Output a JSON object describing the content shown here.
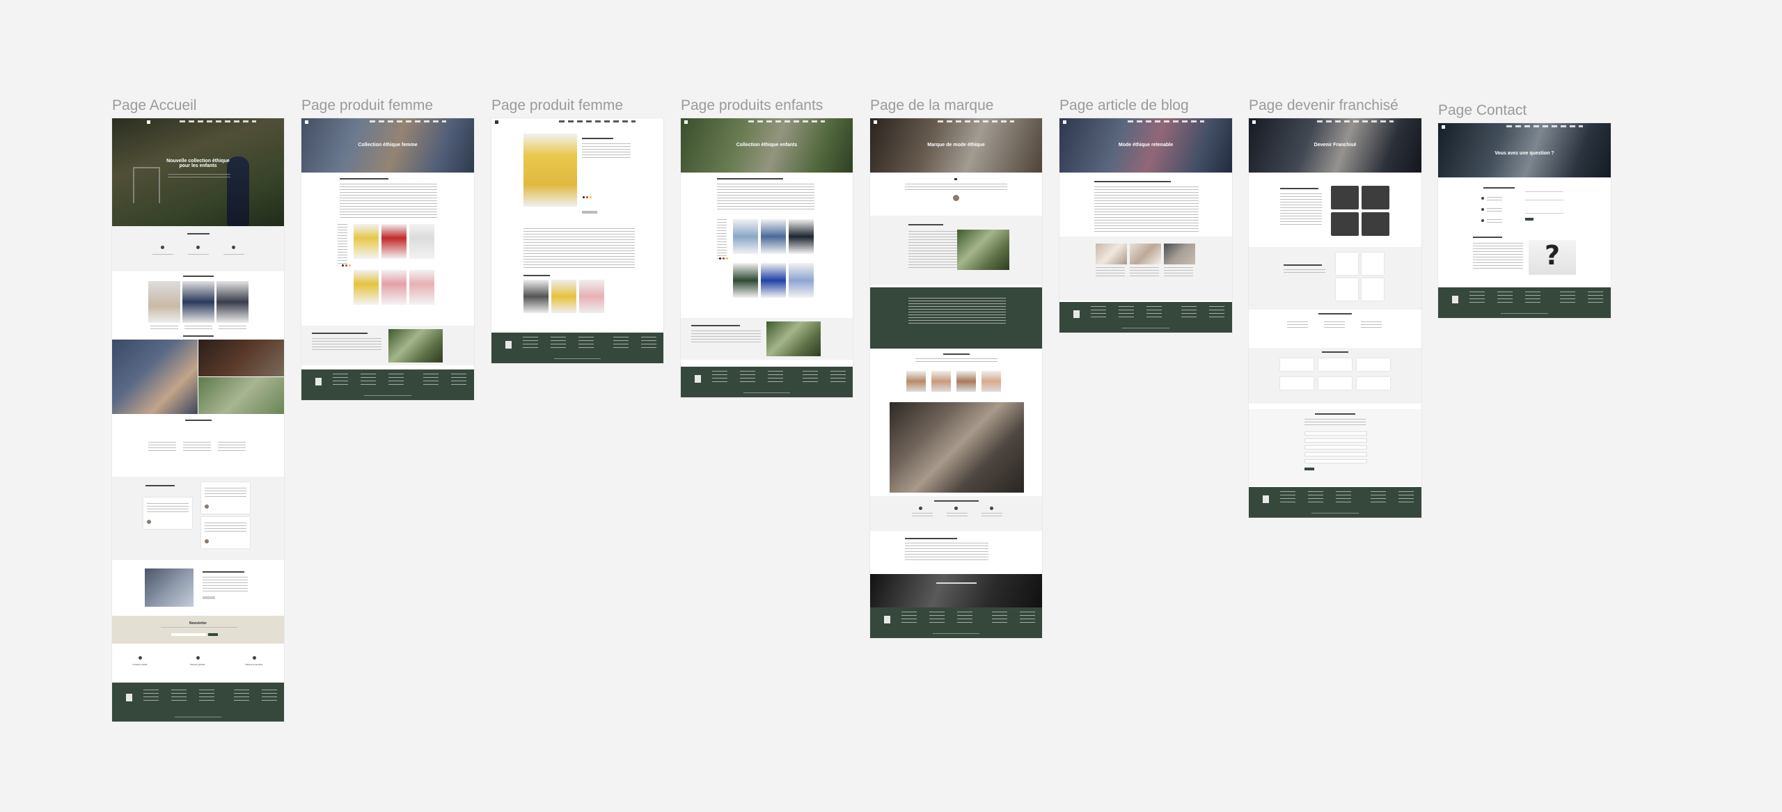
{
  "canvas": {
    "background": "#f3f3f4",
    "label_color": "#9a9a9c"
  },
  "frames": [
    {
      "id": "accueil",
      "label": "Page Accueil",
      "hero_title": "Nouvelle collection éthique pour les enfants"
    },
    {
      "id": "produit-femme-1",
      "label": "Page produit femme",
      "hero_title": "Collection éthique femme"
    },
    {
      "id": "produit-femme-2",
      "label": "Page produit femme",
      "hero_title": ""
    },
    {
      "id": "produits-enfants",
      "label": "Page produits enfants",
      "hero_title": "Collection éthique enfants"
    },
    {
      "id": "marque",
      "label": "Page de la marque",
      "hero_title": "Marque de mode éthique"
    },
    {
      "id": "blog",
      "label": "Page article de blog",
      "hero_title": "Mode éthique retenable"
    },
    {
      "id": "franchise",
      "label": "Page devenir franchisé",
      "hero_title": "Devenir Franchisé"
    },
    {
      "id": "contact",
      "label": "Page Contact",
      "hero_title": "Vous avez une question ?"
    }
  ],
  "accueil": {
    "newsletter_title": "Newsletter",
    "features": [
      "Livraison rapide",
      "Retours gratuits",
      "Paiement sécurisé"
    ]
  },
  "contact": {
    "mystery_glyph": "?"
  },
  "colors": {
    "footer": "#36483c",
    "beige": "#e4dfd3",
    "dark_card": "#3d3d3d"
  },
  "icons": [
    "logo-icon",
    "cart-icon",
    "user-icon",
    "social-icon",
    "quote-icon",
    "question-mark-icon"
  ]
}
